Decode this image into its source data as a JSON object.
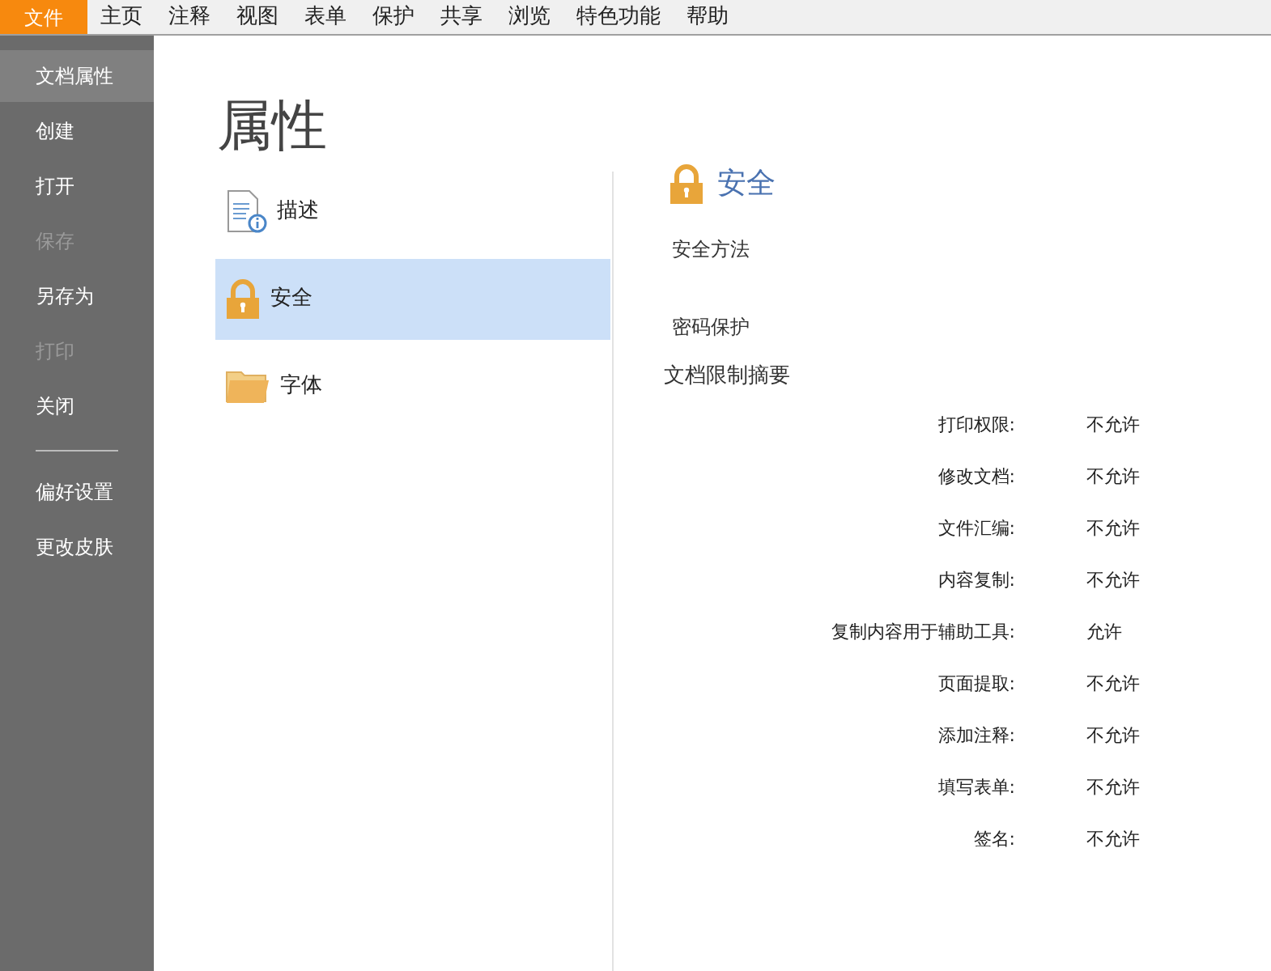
{
  "menu_bar": [
    {
      "label": "文件",
      "selected": true
    },
    {
      "label": "主页",
      "selected": false
    },
    {
      "label": "注释",
      "selected": false
    },
    {
      "label": "视图",
      "selected": false
    },
    {
      "label": "表单",
      "selected": false
    },
    {
      "label": "保护",
      "selected": false
    },
    {
      "label": "共享",
      "selected": false
    },
    {
      "label": "浏览",
      "selected": false
    },
    {
      "label": "特色功能",
      "selected": false
    },
    {
      "label": "帮助",
      "selected": false
    }
  ],
  "sidebar": {
    "items": [
      {
        "label": "文档属性",
        "selected": true,
        "disabled": false
      },
      {
        "label": "创建",
        "selected": false,
        "disabled": false
      },
      {
        "label": "打开",
        "selected": false,
        "disabled": false
      },
      {
        "label": "保存",
        "selected": false,
        "disabled": true
      },
      {
        "label": "另存为",
        "selected": false,
        "disabled": false
      },
      {
        "label": "打印",
        "selected": false,
        "disabled": true
      },
      {
        "label": "关闭",
        "selected": false,
        "disabled": false
      },
      {
        "kind": "separator"
      },
      {
        "label": "偏好设置",
        "selected": false,
        "disabled": false
      },
      {
        "label": "更改皮肤",
        "selected": false,
        "disabled": false
      }
    ]
  },
  "page_title": "属性",
  "categories": [
    {
      "kind": "document",
      "label": "描述",
      "selected": false
    },
    {
      "kind": "lock",
      "label": "安全",
      "selected": true
    },
    {
      "kind": "font",
      "label": "字体",
      "selected": false
    }
  ],
  "detail": {
    "title": "安全",
    "security_method_label": "安全方法",
    "password_label": "密码保护",
    "summary_title": "文档限制摘要",
    "rows": [
      {
        "label": "打印权限:",
        "value": "不允许"
      },
      {
        "label": "修改文档:",
        "value": "不允许"
      },
      {
        "label": "文件汇编:",
        "value": "不允许"
      },
      {
        "label": "内容复制:",
        "value": "不允许"
      },
      {
        "label": "复制内容用于辅助工具:",
        "value": "允许"
      },
      {
        "label": "页面提取:",
        "value": "不允许"
      },
      {
        "label": "添加注释:",
        "value": "不允许"
      },
      {
        "label": "填写表单:",
        "value": "不允许"
      },
      {
        "label": "签名:",
        "value": "不允许"
      }
    ]
  }
}
